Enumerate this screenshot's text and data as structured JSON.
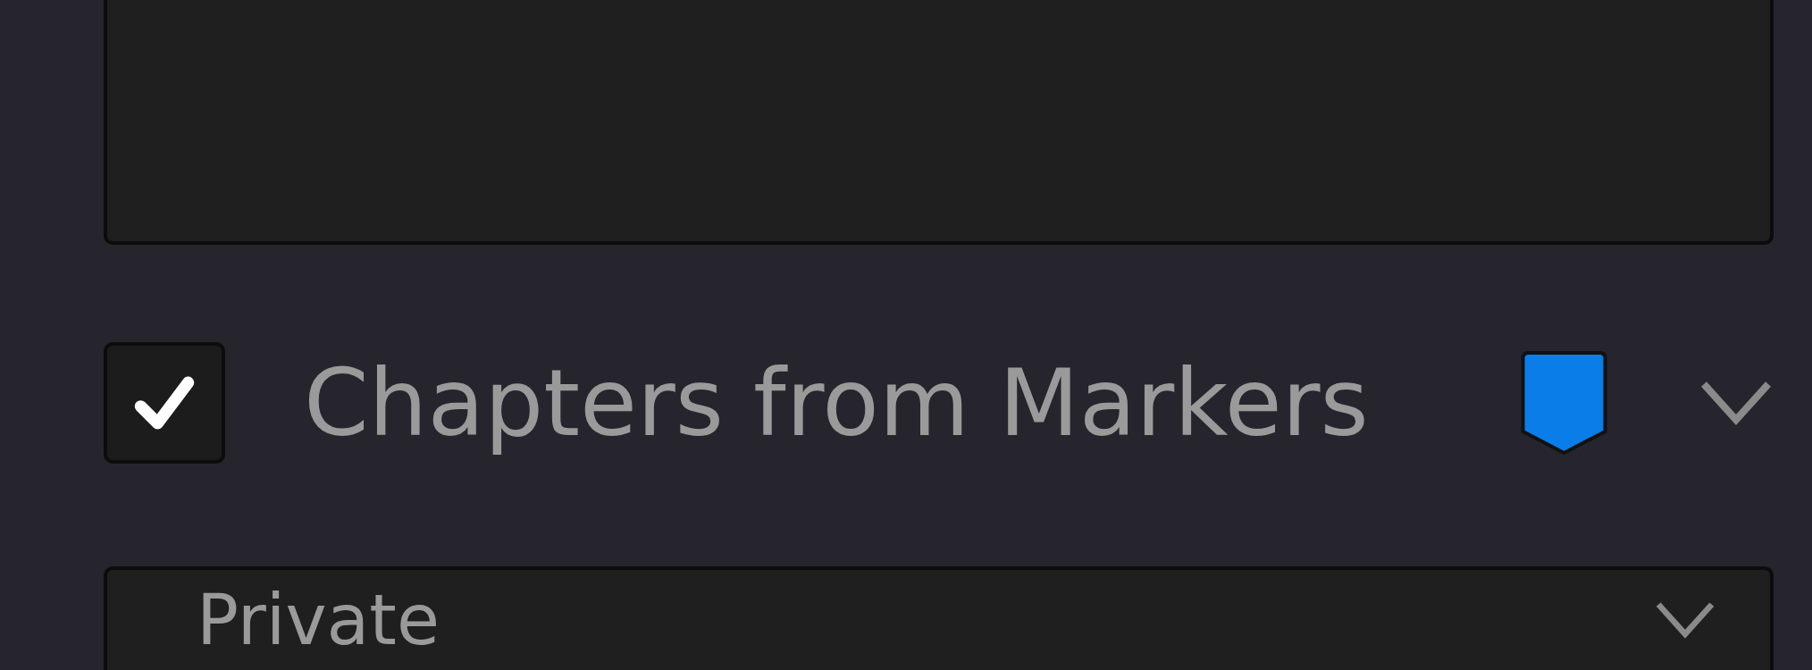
{
  "chapters": {
    "label": "Chapters from Markers",
    "checked": true
  },
  "visibility": {
    "value": "Private"
  }
}
